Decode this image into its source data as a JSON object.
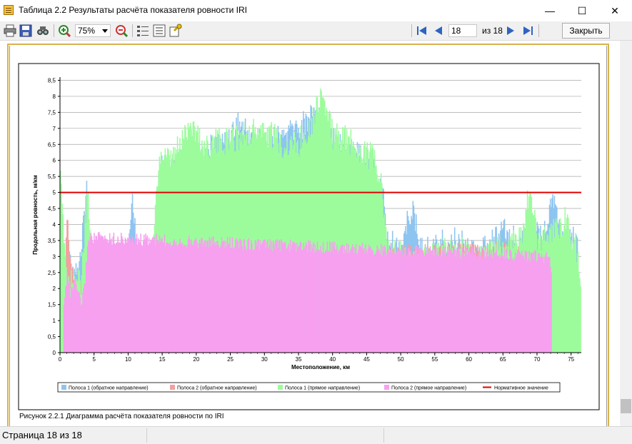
{
  "window": {
    "title": "Таблица 2.2 Результаты расчёта показателя ровности IRI",
    "minimize_label": "—",
    "maximize_label": "☐",
    "close_label": "✕"
  },
  "toolbar": {
    "zoom_value": "75%",
    "page_current": "18",
    "page_total_label": "из 18",
    "close_button_label": "Закрыть",
    "icons": [
      "print-icon",
      "save-icon",
      "find-icon",
      "zoom-in-icon",
      "zoom-out-icon",
      "page-setup-icon",
      "list-icon",
      "export-icon",
      "first-page-icon",
      "prev-page-icon",
      "next-page-icon",
      "last-page-icon"
    ]
  },
  "caption": "Рисунок 2.2.1 Диаграмма расчёта показателя ровности по IRI",
  "status": {
    "page_label": "Страница 18 из 18"
  },
  "colors": {
    "lane1_reverse": "#8ec4f0",
    "lane2_reverse": "#f2a0a0",
    "lane1_forward": "#9cfc9c",
    "lane2_forward": "#f7a0f0",
    "normative": "#e00000",
    "page_border": "#d8b24d"
  },
  "chart_data": {
    "type": "bar",
    "xlabel": "Местоположение, км",
    "ylabel": "Продольная ровность, м/км",
    "xlim": [
      0,
      76.5
    ],
    "ylim": [
      0,
      8.6
    ],
    "xticks": [
      0,
      5,
      10,
      15,
      20,
      25,
      30,
      35,
      40,
      45,
      50,
      55,
      60,
      65,
      70,
      75
    ],
    "yticks": [
      "0",
      "0,5",
      "1",
      "1,5",
      "2",
      "2,5",
      "3",
      "3,5",
      "4",
      "4,5",
      "5",
      "5,5",
      "6",
      "6,5",
      "7",
      "7,5",
      "8",
      "8,5"
    ],
    "grid": "horizontal",
    "legend_position": "bottom",
    "normative_value": 5,
    "series": [
      {
        "name": "Полоса 1 (обратное направление)",
        "color": "#8ec4f0",
        "points": [
          [
            0,
            3.2
          ],
          [
            1,
            3.4
          ],
          [
            2,
            3.0
          ],
          [
            3,
            3.3
          ],
          [
            3.8,
            5.8
          ],
          [
            4.5,
            2.7
          ],
          [
            5.5,
            2.2
          ],
          [
            6.5,
            2.1
          ],
          [
            7.5,
            2.3
          ],
          [
            8.5,
            2.1
          ],
          [
            9.5,
            1.9
          ],
          [
            10.6,
            5.5
          ],
          [
            11.5,
            2.2
          ],
          [
            12.5,
            2.1
          ],
          [
            13.5,
            1.9
          ],
          [
            14.5,
            6.2
          ],
          [
            16,
            6.0
          ],
          [
            18,
            6.5
          ],
          [
            20,
            6.6
          ],
          [
            22,
            6.8
          ],
          [
            24,
            7.0
          ],
          [
            26,
            7.6
          ],
          [
            28,
            7.2
          ],
          [
            30,
            7.0
          ],
          [
            32,
            7.1
          ],
          [
            34,
            7.4
          ],
          [
            36,
            7.6
          ],
          [
            37.1,
            8.1
          ],
          [
            38,
            7.7
          ],
          [
            40,
            7.3
          ],
          [
            42,
            6.9
          ],
          [
            44,
            6.6
          ],
          [
            46,
            6.3
          ],
          [
            47.5,
            5.2
          ],
          [
            48,
            3.9
          ],
          [
            50,
            3.7
          ],
          [
            51.5,
            5.0
          ],
          [
            53,
            3.6
          ],
          [
            55,
            3.8
          ],
          [
            57,
            3.9
          ],
          [
            59,
            4.0
          ],
          [
            61,
            3.6
          ],
          [
            63,
            3.8
          ],
          [
            65,
            4.2
          ],
          [
            67,
            3.9
          ],
          [
            69,
            4.1
          ],
          [
            71,
            4.3
          ],
          [
            72.3,
            5.4
          ],
          [
            73.5,
            4.0
          ],
          [
            75,
            3.9
          ],
          [
            76,
            4.6
          ]
        ]
      },
      {
        "name": "Полоса 2 (обратное направление)",
        "color": "#f2a0a0",
        "points": [
          [
            0.6,
            2.8
          ],
          [
            1.0,
            4.5
          ],
          [
            1.4,
            3.2
          ],
          [
            2.0,
            2.4
          ],
          [
            2.6,
            2.3
          ],
          [
            3.1,
            2.6
          ],
          [
            3.6,
            3.3
          ],
          [
            4.0,
            3.2
          ],
          [
            71.8,
            3.5
          ],
          [
            72.2,
            3.2
          ]
        ]
      },
      {
        "name": "Полоса 1 (прямое направление)",
        "color": "#9cfc9c",
        "points": [
          [
            0,
            5.7
          ],
          [
            1,
            2.7
          ],
          [
            2,
            2.8
          ],
          [
            3,
            2.6
          ],
          [
            4,
            5.4
          ],
          [
            5,
            2.5
          ],
          [
            6,
            2.1
          ],
          [
            7,
            2.0
          ],
          [
            8,
            2.1
          ],
          [
            9,
            1.9
          ],
          [
            10,
            2.0
          ],
          [
            11,
            2.3
          ],
          [
            12,
            1.9
          ],
          [
            13,
            1.8
          ],
          [
            14.5,
            6.6
          ],
          [
            16,
            6.4
          ],
          [
            17.5,
            6.9
          ],
          [
            19,
            7.7
          ],
          [
            21,
            6.9
          ],
          [
            23,
            7.0
          ],
          [
            25,
            7.1
          ],
          [
            27,
            7.3
          ],
          [
            29,
            7.4
          ],
          [
            31,
            7.2
          ],
          [
            33,
            6.9
          ],
          [
            35,
            7.0
          ],
          [
            37,
            7.7
          ],
          [
            38.2,
            8.6
          ],
          [
            40,
            7.2
          ],
          [
            42,
            7.1
          ],
          [
            44,
            6.8
          ],
          [
            46,
            6.5
          ],
          [
            47,
            5.7
          ],
          [
            48,
            3.6
          ],
          [
            50,
            3.5
          ],
          [
            52,
            3.2
          ],
          [
            54,
            3.4
          ],
          [
            56,
            3.6
          ],
          [
            58,
            3.7
          ],
          [
            60,
            3.5
          ],
          [
            62,
            3.4
          ],
          [
            64,
            3.7
          ],
          [
            66,
            3.8
          ],
          [
            68,
            4.1
          ],
          [
            68.8,
            5.6
          ],
          [
            70,
            4.0
          ],
          [
            72,
            4.2
          ],
          [
            74,
            4.6
          ],
          [
            75.5,
            3.9
          ],
          [
            76.5,
            2.7
          ]
        ]
      },
      {
        "name": "Полоса 2 (прямое направление)",
        "color": "#f7a0f0",
        "points": [
          [
            0.5,
            1.6
          ],
          [
            1.0,
            2.8
          ],
          [
            1.5,
            2.0
          ],
          [
            2.0,
            2.4
          ],
          [
            2.5,
            2.1
          ],
          [
            3.0,
            1.7
          ],
          [
            3.5,
            2.2
          ],
          [
            4.1,
            3.8
          ],
          [
            71.8,
            3.2
          ],
          [
            72.2,
            2.0
          ]
        ]
      },
      {
        "name": "Нормативное значение",
        "color": "#e00000",
        "points": [
          [
            0,
            5
          ],
          [
            76.5,
            5
          ]
        ]
      }
    ]
  }
}
